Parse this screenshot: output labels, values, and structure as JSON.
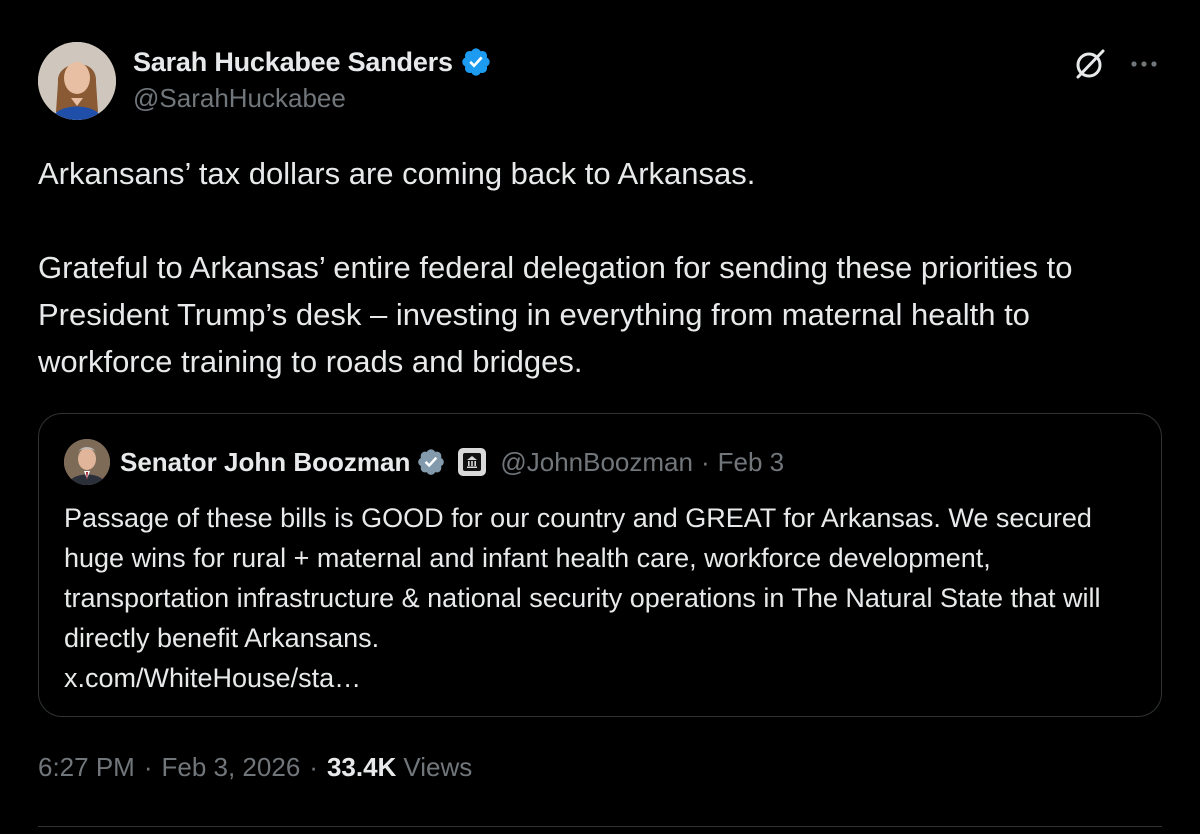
{
  "colors": {
    "background": "#000000",
    "primary_text": "#e7e9ea",
    "secondary_text": "#71767b",
    "verified_badge": "#1d9bf0",
    "border": "#2f3336"
  },
  "post": {
    "author": {
      "display_name": "Sarah Huckabee Sanders",
      "handle": "@SarahHuckabee",
      "verified_icon": "verified-badge-icon"
    },
    "icons": {
      "grok": "grok-icon",
      "more": "more-icon"
    },
    "text_line1": "Arkansans’ tax dollars are coming back to Arkansas.",
    "text_line2": "Grateful to Arkansas’ entire federal delegation for sending these priorities to President Trump’s desk – investing in everything from maternal health to workforce training to roads and bridges.",
    "quote": {
      "display_name": "Senator John Boozman",
      "handle": "@JohnBoozman",
      "dot": "·",
      "date": "Feb 3",
      "affiliation_icon": "government-affiliation-icon",
      "text": "Passage of these bills is GOOD for our country and GREAT for Arkansas. We secured huge wins for rural + maternal and infant health care, workforce development, transportation infrastructure & national security operations in The Natural State that will directly benefit Arkansans.",
      "link": "x.com/WhiteHouse/sta…"
    },
    "meta": {
      "time": "6:27 PM",
      "sep1": "·",
      "date": "Feb 3, 2026",
      "sep2": "·",
      "views_count": "33.4K",
      "views_label": "Views"
    }
  }
}
